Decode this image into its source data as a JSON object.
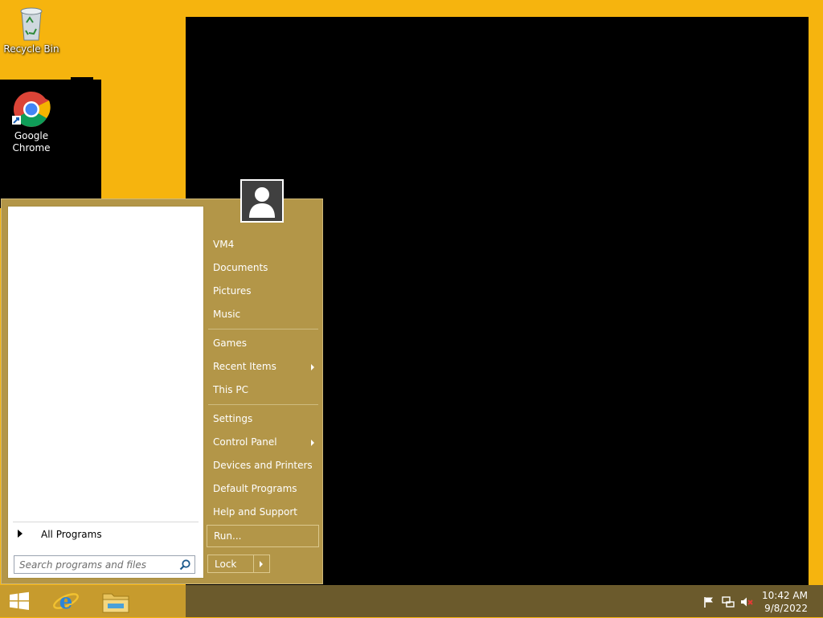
{
  "desktop": {
    "icons": [
      {
        "label": "Recycle Bin",
        "icon": "recycle-bin-icon"
      },
      {
        "label_line1": "Google",
        "label_line2": "Chrome",
        "icon": "chrome-icon"
      }
    ]
  },
  "start_menu": {
    "all_programs": "All Programs",
    "search_placeholder": "Search programs and files",
    "user_avatar": "user-icon",
    "items": {
      "vm4": "VM4",
      "documents": "Documents",
      "pictures": "Pictures",
      "music": "Music",
      "games": "Games",
      "recent_items": "Recent Items",
      "this_pc": "This PC",
      "settings": "Settings",
      "control_panel": "Control Panel",
      "devices_printers": "Devices and Printers",
      "default_programs": "Default Programs",
      "help_support": "Help and Support",
      "run": "Run..."
    },
    "lock": "Lock"
  },
  "taskbar": {
    "pinned": [
      "windows-start-icon",
      "internet-explorer-icon",
      "file-explorer-icon"
    ],
    "tray": [
      "action-center-flag-icon",
      "network-icon",
      "volume-muted-icon"
    ],
    "time": "10:42 AM",
    "date": "9/8/2022"
  },
  "colors": {
    "desktop": "#f6b40e",
    "menu": "#b39648",
    "taskbar": "#6b5a2c"
  }
}
